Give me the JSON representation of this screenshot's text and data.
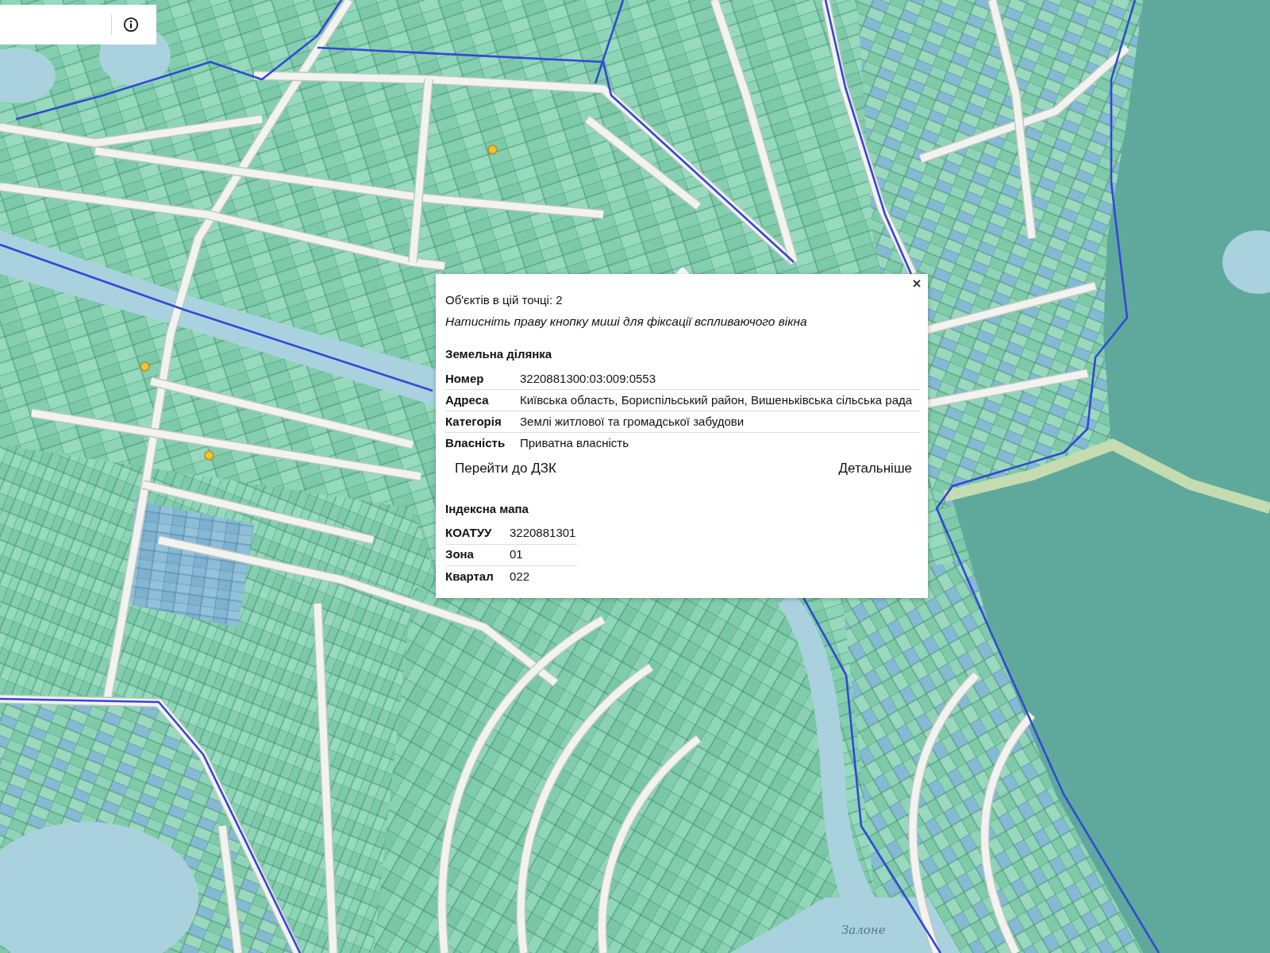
{
  "map": {
    "labels": [
      {
        "text": "Залоне"
      }
    ]
  },
  "popup": {
    "objects_line": "Об'єктів в цій точці: 2",
    "hint": "Натисніть праву кнопку миші для фіксації вспливаючого вікна",
    "sections": [
      {
        "kind": "parcel",
        "title": "Земельна ділянка",
        "rows": [
          {
            "label": "Номер",
            "value": "3220881300:03:009:0553"
          },
          {
            "label": "Адреса",
            "value": "Київська область, Бориспільський район, Вишеньківська сільська рада"
          },
          {
            "label": "Категорія",
            "value": "Землі житлової та громадської забудови"
          },
          {
            "label": "Власність",
            "value": "Приватна власність"
          }
        ],
        "actions": [
          {
            "label": "Перейти до ДЗК"
          },
          {
            "label": "Детальніше"
          }
        ]
      },
      {
        "kind": "index",
        "title": "Індексна мапа",
        "rows": [
          {
            "label": "КОАТУУ",
            "value": "3220881301"
          },
          {
            "label": "Зона",
            "value": "01"
          },
          {
            "label": "Квартал",
            "value": "022"
          }
        ]
      }
    ]
  }
}
